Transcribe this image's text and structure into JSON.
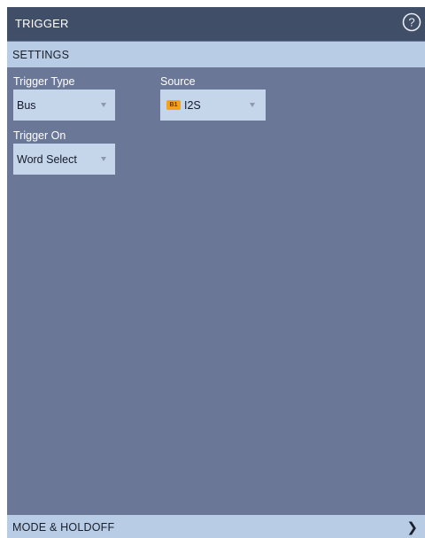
{
  "header": {
    "title": "TRIGGER",
    "help_icon": "help-circle-icon"
  },
  "settings_section": {
    "label": "SETTINGS"
  },
  "trigger_type": {
    "label": "Trigger Type",
    "value": "Bus"
  },
  "source": {
    "label": "Source",
    "badge": "B1",
    "value": "I2S"
  },
  "trigger_on": {
    "label": "Trigger On",
    "value": "Word Select"
  },
  "mode_holdoff_section": {
    "label": "MODE & HOLDOFF",
    "icon": "chevron-right-icon"
  },
  "colors": {
    "panel_bg": "#6a7796",
    "title_bg": "#414e68",
    "section_bg": "#b8cce5",
    "dropdown_bg": "#c6d6ea",
    "badge_bg": "#f2a21c"
  }
}
